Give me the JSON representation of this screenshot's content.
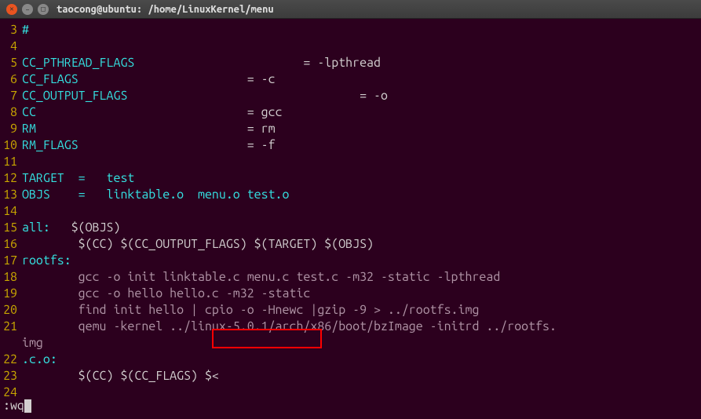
{
  "window": {
    "title": "taocong@ubuntu: /home/LinuxKernel/menu"
  },
  "lines": {
    "l3": {
      "no": "3",
      "hash": "#"
    },
    "l4": {
      "no": "4"
    },
    "l5": {
      "no": "5",
      "var": "CC_PTHREAD_FLAGS",
      "val": "= -lpthread",
      "spaces": "                        "
    },
    "l6": {
      "no": "6",
      "var": "CC_FLAGS",
      "val": "= -c",
      "spaces": "                        "
    },
    "l7": {
      "no": "7",
      "var": "CC_OUTPUT_FLAGS",
      "val": "= -o",
      "spaces": "                                 "
    },
    "l8": {
      "no": "8",
      "var": "CC",
      "val": "= gcc",
      "spaces": "                              "
    },
    "l9": {
      "no": "9",
      "var": "RM",
      "val": "= rm",
      "spaces": "                              "
    },
    "l10": {
      "no": "10",
      "var": "RM_FLAGS",
      "val": "= -f",
      "spaces": "                        "
    },
    "l11": {
      "no": "11"
    },
    "l12": {
      "no": "12",
      "var": "TARGET  =   test"
    },
    "l13": {
      "no": "13",
      "var": "OBJS    =   linktable.o  menu.o test.o"
    },
    "l14": {
      "no": "14"
    },
    "l15": {
      "no": "15",
      "target": "all:",
      "deps": "   $(OBJS)"
    },
    "l16": {
      "no": "16",
      "cmd": "        $(CC) $(CC_OUTPUT_FLAGS) $(TARGET) $(OBJS)"
    },
    "l17": {
      "no": "17",
      "target": "rootfs:"
    },
    "l18": {
      "no": "18",
      "cmd": "        gcc -o init linktable.c menu.c test.c -m32 -static -lpthread"
    },
    "l19": {
      "no": "19",
      "cmd": "        gcc -o hello hello.c -m32 -static"
    },
    "l20": {
      "no": "20",
      "cmd": "        find init hello | cpio -o -Hnewc |gzip -9 > ../rootfs.img"
    },
    "l21": {
      "no": "21",
      "cmd": "        qemu -kernel ../linux-5.0.1/arch/x86/boot/bzImage -initrd ../rootfs."
    },
    "l21b": {
      "cmd": "img"
    },
    "l22": {
      "no": "22",
      "target": ".c.o:"
    },
    "l23": {
      "no": "23",
      "cmd": "        $(CC) $(CC_FLAGS) $<"
    },
    "l24": {
      "no": "24"
    }
  },
  "command": ":wq",
  "highlight": {
    "text": "/linux-5.0.1/"
  }
}
